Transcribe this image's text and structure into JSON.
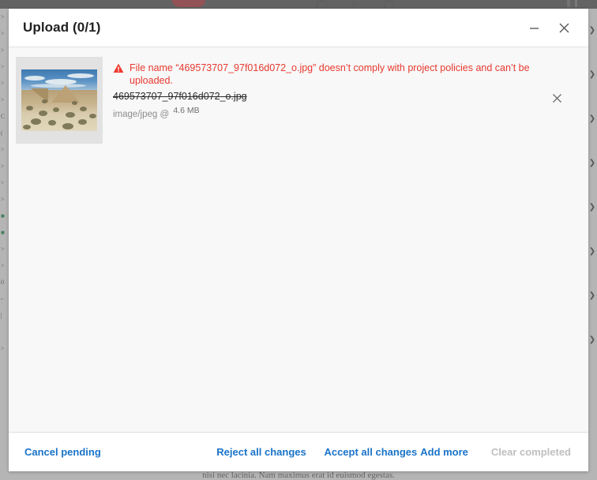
{
  "background": {
    "bottom_text": "nisi nec lacinia. Nam maximus erat id euismod egestas.",
    "left_rail_marks": ">\n>\n>\n>\n>\n>\n>\nC\n(\n>\n>\n>\n>\n>\n>\n■\n■\n>\n>\n0\n⌐\n|\n-\n>",
    "right_rail_marks": "❯\n❯\n❯\n❯\n❯\n❯\n❯\n❯",
    "toolbar_icons": [
      "◌",
      "✂",
      "◌",
      "▌"
    ]
  },
  "dialog": {
    "title": "Upload (0/1)",
    "minimize_label": "Minimize",
    "close_label": "Close"
  },
  "files": [
    {
      "error_message": "File name “469573707_97f016d072_o.jpg” doesn’t comply with project policies and can’t be uploaded.",
      "name": "469573707_97f016d072_o.jpg",
      "mime_type": "image/jpeg",
      "separator": "@",
      "size": "4.6 MB",
      "dismiss_label": "Dismiss",
      "thumbnail_alt": "desert landscape photo"
    }
  ],
  "footer": {
    "cancel_pending": "Cancel pending",
    "reject_all": "Reject all changes",
    "accept_all": "Accept all changes",
    "add_more": "Add more",
    "clear_completed": "Clear completed"
  },
  "colors": {
    "link": "#1a73c8",
    "link_disabled": "#bfbfbf",
    "error": "#e8392f",
    "dialog_bg": "#f8f8f8",
    "header_bg": "#ffffff"
  }
}
